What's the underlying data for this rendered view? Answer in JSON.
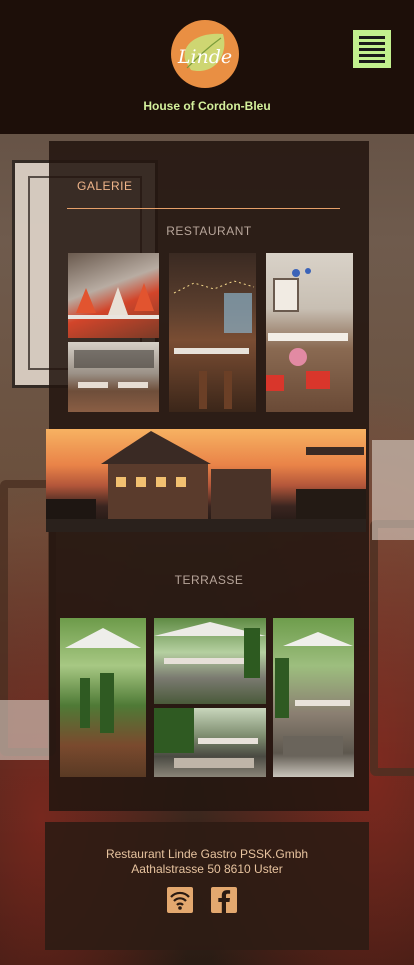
{
  "header": {
    "logo_text": "Linde",
    "tagline": "House of Cordon-Bleu"
  },
  "gallery": {
    "title": "GALERIE",
    "restaurant_title": "RESTAURANT",
    "terrace_title": "TERRASSE"
  },
  "footer": {
    "company": "Restaurant Linde Gastro PSSK.Gmbh",
    "address": "Aathalstrasse 50 8610 Uster"
  },
  "icons": {
    "menu": "hamburger-menu-icon",
    "wifi": "wifi-icon",
    "facebook": "facebook-icon"
  },
  "colors": {
    "header_bg": "#1d0f09",
    "accent_green": "#c2f08e",
    "accent_orange": "#e98f43"
  }
}
